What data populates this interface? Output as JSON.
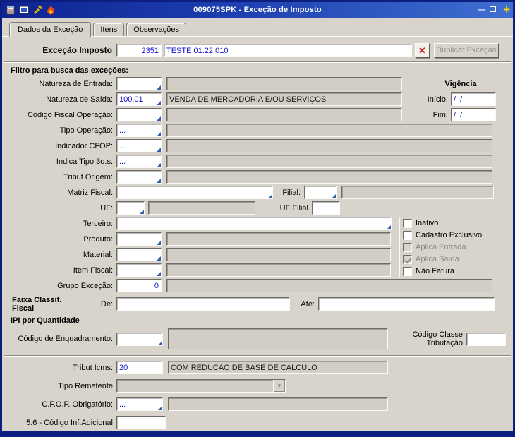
{
  "window": {
    "title": "009075SPK - Exceção de Imposto"
  },
  "icons": {
    "minimize": "—",
    "plus": "+",
    "delete": "✕",
    "dropdown": "▼"
  },
  "tabs": [
    "Dados da Exceção",
    "Itens",
    "Observações"
  ],
  "header": {
    "label": "Exceção Imposto",
    "code": "2351",
    "description": "TESTE 01.22.010",
    "duplicate_label": "Duplicar Exceção"
  },
  "filter": {
    "title": "Filtro para busca das exceções:",
    "vigencia": {
      "title": "Vigência",
      "inicio_label": "Início:",
      "inicio_value": "/  /",
      "fim_label": "Fim:",
      "fim_value": "/  /"
    },
    "rows": {
      "natureza_entrada": {
        "label": "Natureza de Entrada:",
        "value": "",
        "desc": ""
      },
      "natureza_saida": {
        "label": "Natureza de Saída:",
        "value": "100.01",
        "desc": "VENDA DE MERCADORIA E/OU SERVIÇOS"
      },
      "codigo_fiscal_operacao": {
        "label": "Código Fiscal Operação:",
        "value": "",
        "desc": ""
      },
      "tipo_operacao": {
        "label": "Tipo Operação:",
        "value": "...",
        "desc": ""
      },
      "indicador_cfop": {
        "label": "Indicador CFOP:",
        "value": "...",
        "desc": ""
      },
      "indica_tipo_3os": {
        "label": "Indica Tipo 3o.s:",
        "value": "...",
        "desc": ""
      },
      "tribut_origem": {
        "label": "Tribut Origem:",
        "value": "",
        "desc": ""
      },
      "matriz_fiscal": {
        "label": "Matriz Fiscal:",
        "value": ""
      },
      "filial": {
        "label": "Filial:",
        "value": "",
        "desc": ""
      },
      "uf": {
        "label": "UF:",
        "value": "",
        "desc": ""
      },
      "uf_filial": {
        "label": "UF Filial",
        "value": ""
      },
      "terceiro": {
        "label": "Terceiro:",
        "value": ""
      },
      "produto": {
        "label": "Produto:",
        "value": "",
        "desc": ""
      },
      "material": {
        "label": "Material:",
        "value": "",
        "desc": ""
      },
      "item_fiscal": {
        "label": "Item Fiscal:",
        "value": "",
        "desc": ""
      },
      "grupo_excecao": {
        "label": "Grupo Exceção:",
        "value": "0",
        "desc": ""
      }
    },
    "checkboxes": [
      {
        "label": "Inativo",
        "checked": false,
        "disabled": false
      },
      {
        "label": "Cadastro Exclusivo",
        "checked": false,
        "disabled": false
      },
      {
        "label": "Aplica Entrada",
        "checked": false,
        "disabled": true
      },
      {
        "label": "Aplica Saída",
        "checked": true,
        "disabled": true
      },
      {
        "label": "Não Fatura",
        "checked": false,
        "disabled": false
      }
    ]
  },
  "faixa": {
    "title": "Faixa Classif. Fiscal",
    "de_label": "De:",
    "de_value": "",
    "ate_label": "Até:",
    "ate_value": ""
  },
  "ipi": {
    "title": "IPI por Quantidade",
    "enquadramento_label": "Código de Enquadramento:",
    "enquadramento_value": "",
    "enquadramento_desc": "",
    "classe_label_1": "Código Classe",
    "classe_label_2": "Tributação",
    "classe_value": ""
  },
  "bottom": {
    "tribut_icms": {
      "label": "Tribut Icms:",
      "value": "20",
      "desc": "COM REDUCAO DE BASE DE CALCULO"
    },
    "tipo_remetente": {
      "label": "Tipo Remetente",
      "value": ""
    },
    "cfop_obrigatorio": {
      "label": "C.F.O.P. Obrigatório:",
      "value": "...",
      "desc": ""
    },
    "codigo_inf_adicional": {
      "label": "5.6 - Código Inf.Adicional",
      "value": ""
    }
  }
}
